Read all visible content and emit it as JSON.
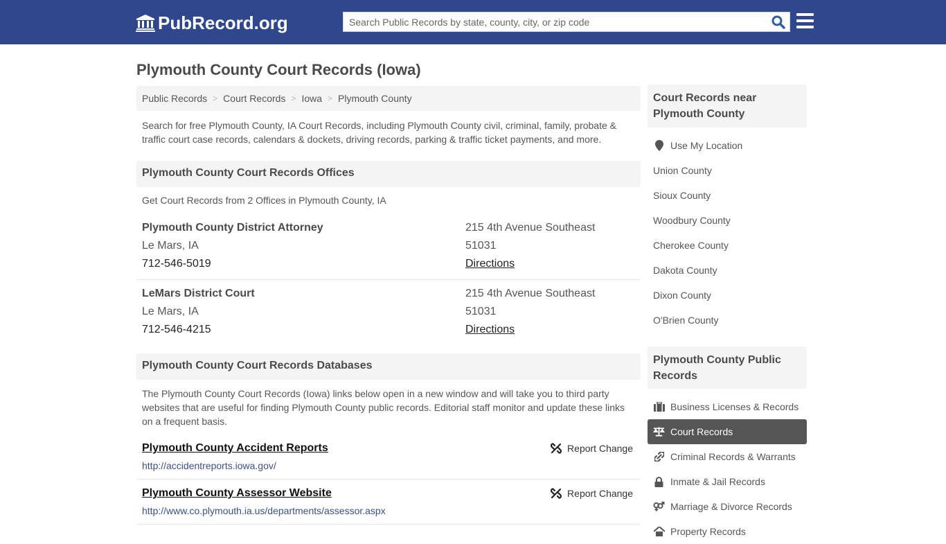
{
  "header": {
    "logo_text": "PubRecord.org",
    "logo_icon": "courthouse-icon",
    "search_placeholder": "Search Public Records by state, county, city, or zip code",
    "search_value": "",
    "search_icon": "search-icon",
    "menu_icon": "hamburger-menu-icon",
    "brand_color": "#2e478d"
  },
  "page": {
    "title": "Plymouth County Court Records (Iowa)",
    "breadcrumb": [
      "Public Records",
      "Court Records",
      "Iowa",
      "Plymouth County"
    ],
    "breadcrumb_separator": ">",
    "intro": "Search for free Plymouth County, IA Court Records, including Plymouth County civil, criminal, family, probate & traffic court case records, calendars & dockets, driving records, parking & traffic ticket payments, and more."
  },
  "offices": {
    "heading": "Plymouth County Court Records Offices",
    "subtitle": "Get Court Records from 2 Offices in Plymouth County, IA",
    "items": [
      {
        "name": "Plymouth County District Attorney",
        "city": "Le Mars, IA",
        "phone": "712-546-5019",
        "address": "215 4th Avenue Southeast",
        "zip": "51031",
        "directions_label": "Directions"
      },
      {
        "name": "LeMars District Court",
        "city": "Le Mars, IA",
        "phone": "712-546-4215",
        "address": "215 4th Avenue Southeast",
        "zip": "51031",
        "directions_label": "Directions"
      }
    ]
  },
  "databases": {
    "heading": "Plymouth County Court Records Databases",
    "intro": "The Plymouth County Court Records (Iowa) links below open in a new window and will take you to third party websites that are useful for finding Plymouth County public records. Editorial staff monitor and update these links on a frequent basis.",
    "report_label": "Report Change",
    "items": [
      {
        "title": "Plymouth County Accident Reports",
        "url": "http://accidentreports.iowa.gov/"
      },
      {
        "title": "Plymouth County Assessor Website",
        "url": "http://www.co.plymouth.ia.us/departments/assessor.aspx"
      }
    ]
  },
  "sidebar": {
    "nearby_heading": "Court Records near Plymouth County",
    "use_location_label": "Use My Location",
    "nearby": [
      "Union County",
      "Sioux County",
      "Woodbury County",
      "Cherokee County",
      "Dakota County",
      "Dixon County",
      "O'Brien County"
    ],
    "public_heading": "Plymouth County Public Records",
    "public_links": [
      {
        "label": "Business Licenses & Records",
        "icon": "briefcase-icon",
        "active": false
      },
      {
        "label": "Court Records",
        "icon": "scales-icon",
        "active": true
      },
      {
        "label": "Criminal Records & Warrants",
        "icon": "link-icon",
        "active": false
      },
      {
        "label": "Inmate & Jail Records",
        "icon": "lock-icon",
        "active": false
      },
      {
        "label": "Marriage & Divorce Records",
        "icon": "gender-icon",
        "active": false
      },
      {
        "label": "Property Records",
        "icon": "home-icon",
        "active": false
      }
    ]
  }
}
